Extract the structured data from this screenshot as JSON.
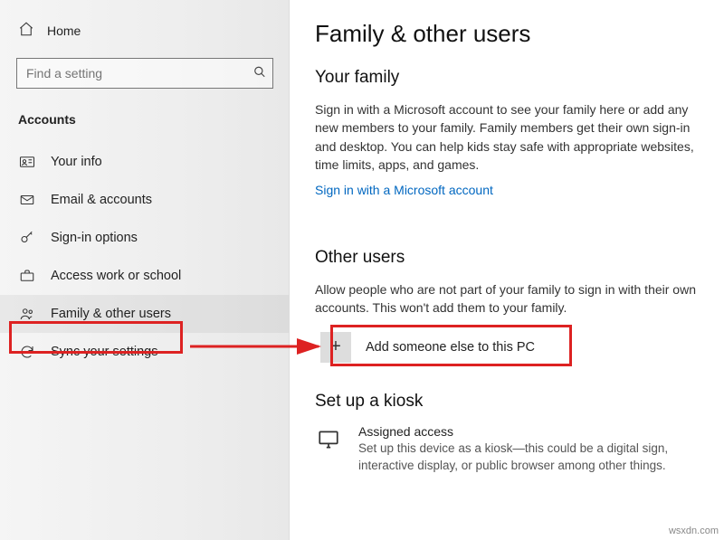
{
  "sidebar": {
    "home_label": "Home",
    "search_placeholder": "Find a setting",
    "section_title": "Accounts",
    "items": [
      {
        "label": "Your info"
      },
      {
        "label": "Email & accounts"
      },
      {
        "label": "Sign-in options"
      },
      {
        "label": "Access work or school"
      },
      {
        "label": "Family & other users"
      },
      {
        "label": "Sync your settings"
      }
    ]
  },
  "content": {
    "page_title": "Family & other users",
    "family": {
      "heading": "Your family",
      "body": "Sign in with a Microsoft account to see your family here or add any new members to your family. Family members get their own sign-in and desktop. You can help kids stay safe with appropriate websites, time limits, apps, and games.",
      "link": "Sign in with a Microsoft account"
    },
    "other": {
      "heading": "Other users",
      "body": "Allow people who are not part of your family to sign in with their own accounts. This won't add them to your family.",
      "add_label": "Add someone else to this PC"
    },
    "kiosk": {
      "heading": "Set up a kiosk",
      "item_title": "Assigned access",
      "item_desc": "Set up this device as a kiosk—this could be a digital sign, interactive display, or public browser among other things."
    }
  },
  "watermark": "wsxdn.com"
}
